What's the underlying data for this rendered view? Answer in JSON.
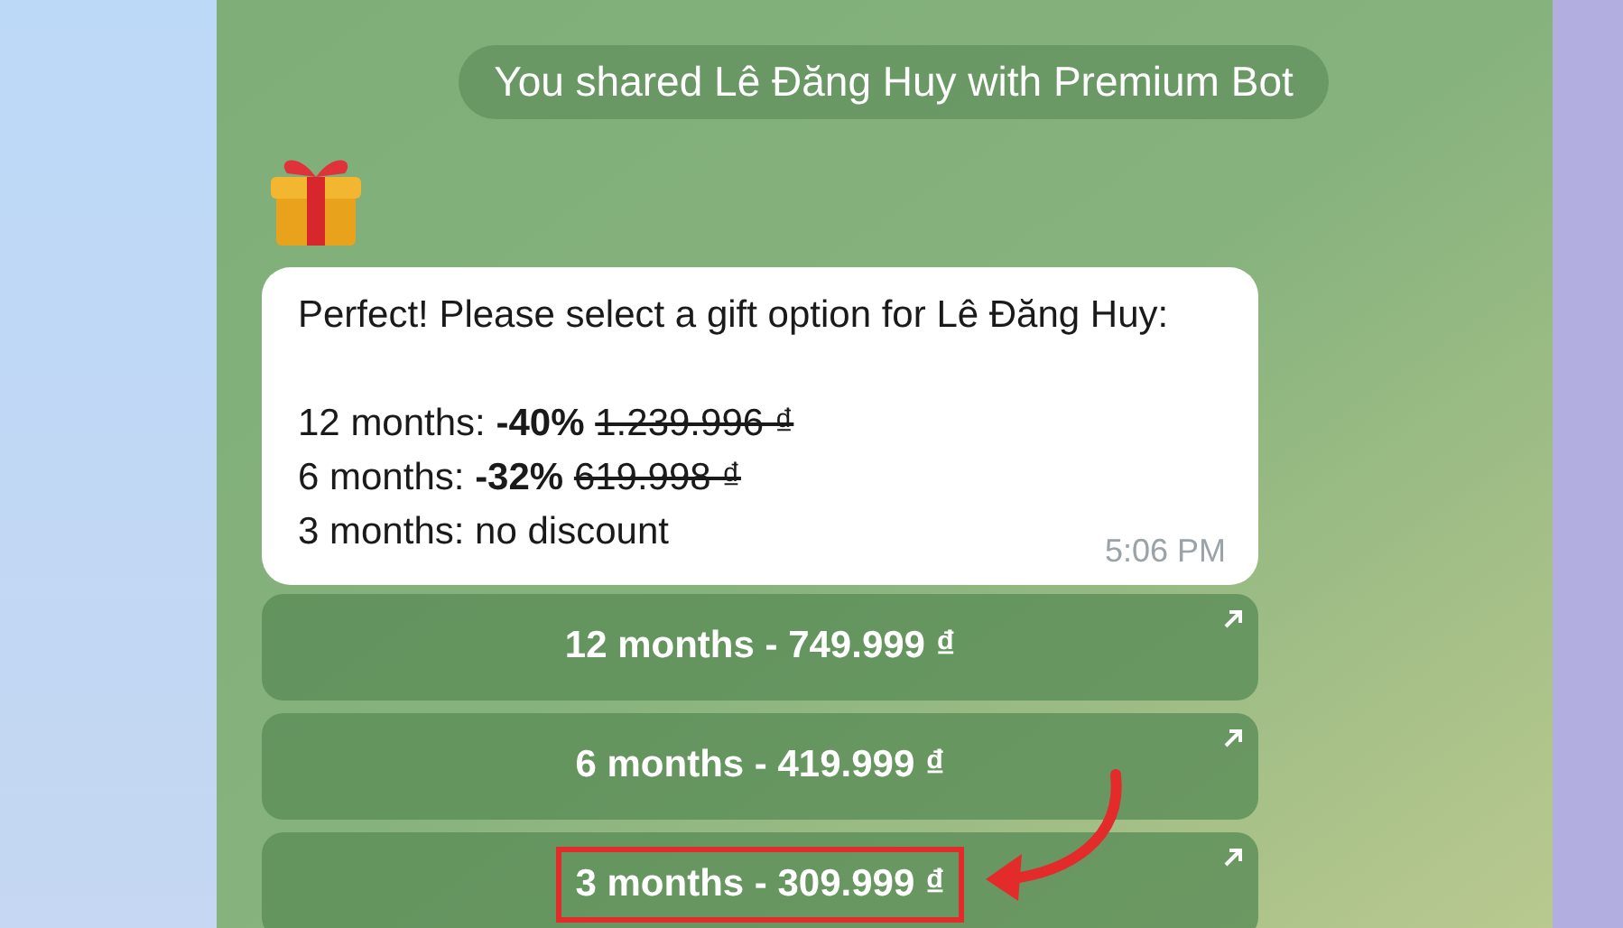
{
  "service_message": "You shared Lê Đăng Huy with Premium Bot",
  "message": {
    "intro": "Perfect! Please select a gift option for Lê Đăng Huy:",
    "lines": [
      {
        "label": "12 months:",
        "discount": "-40%",
        "old_price": "1.239.996 ₫"
      },
      {
        "label": "6 months:",
        "discount": "-32%",
        "old_price": "619.998 ₫"
      },
      {
        "label": "3 months: no discount"
      }
    ],
    "time": "5:06 PM"
  },
  "buttons": [
    {
      "label": "12 months - 749.999 ₫",
      "highlighted": false
    },
    {
      "label": "6 months - 419.999 ₫",
      "highlighted": false
    },
    {
      "label": "3 months - 309.999 ₫",
      "highlighted": true
    }
  ]
}
